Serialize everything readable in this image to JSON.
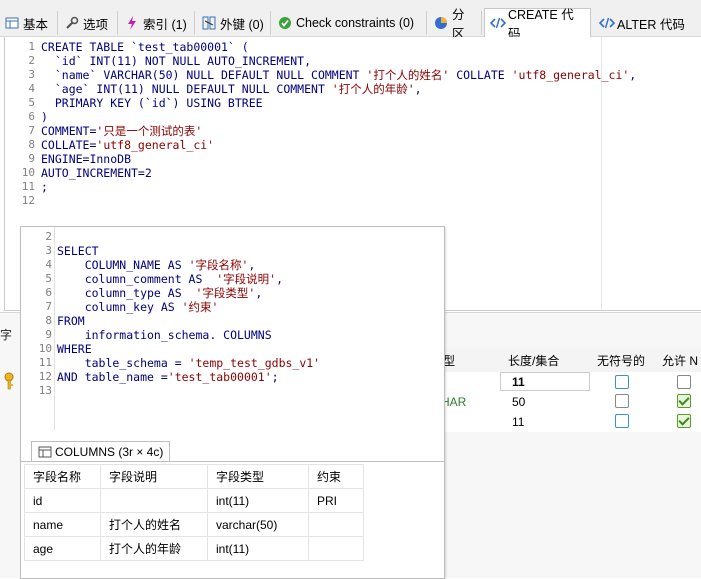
{
  "tabs": [
    {
      "label": "基本",
      "icon": "table-icon"
    },
    {
      "label": "选项",
      "icon": "wrench-icon"
    },
    {
      "label": "索引 (1)",
      "icon": "lightning-icon"
    },
    {
      "label": "外键 (0)",
      "icon": "foreign-key-icon"
    },
    {
      "label": "Check constraints (0)",
      "icon": "check-circle-icon"
    },
    {
      "label": "分区",
      "icon": "pie-chart-icon"
    },
    {
      "label": "CREATE 代码",
      "icon": "code-icon"
    },
    {
      "label": "ALTER 代码",
      "icon": "code-icon"
    }
  ],
  "active_tab": "CREATE 代码",
  "editor": {
    "line_numbers": [
      "1",
      "2",
      "3",
      "4",
      "5",
      "6",
      "7",
      "8",
      "9",
      "10",
      "11",
      "12"
    ],
    "l1": {
      "a": "CREATE TABLE `test_tab00001` ("
    },
    "l2": {
      "a": "  `id` ",
      "b": "INT(11) NOT NULL AUTO_INCREMENT,"
    },
    "l3": {
      "a": "  `name` ",
      "b": "VARCHAR(50) NULL DEFAULT NULL COMMENT ",
      "c": "'打个人的姓名'",
      "d": " COLLATE ",
      "e": "'utf8_general_ci'",
      "f": ","
    },
    "l4": {
      "a": "  `age` ",
      "b": "INT(11) NULL DEFAULT NULL COMMENT ",
      "c": "'打个人的年龄'",
      "d": ","
    },
    "l5": {
      "a": "  PRIMARY KEY (`id`) USING BTREE"
    },
    "l6": {
      "a": ")"
    },
    "l7": {
      "a": "COMMENT=",
      "b": "'只是一个测试的表'"
    },
    "l8": {
      "a": "COLLATE=",
      "b": "'utf8_general_ci'"
    },
    "l9": {
      "a": "ENGINE=InnoDB"
    },
    "l10": {
      "a": "AUTO_INCREMENT=2"
    },
    "l11": {
      "a": ";"
    }
  },
  "background_grid": {
    "headers": [
      "型",
      "长度/集合",
      "无符号的",
      "允许 N"
    ],
    "rows": [
      {
        "type": "",
        "length": "11"
      },
      {
        "type": "HAR",
        "length": "50"
      },
      {
        "type": "",
        "length": "11"
      }
    ],
    "left_fragment": "字"
  },
  "sql_panel": {
    "line_numbers": [
      "2",
      "3",
      "4",
      "5",
      "6",
      "7",
      "8",
      "9",
      "10",
      "11",
      "12",
      "13"
    ],
    "l3": {
      "a": "SELECT"
    },
    "l4": {
      "a": "    COLUMN_NAME AS ",
      "b": "'字段名称'",
      "c": ","
    },
    "l5": {
      "a": "    column_comment AS  ",
      "b": "'字段说明'",
      "c": ","
    },
    "l6": {
      "a": "    column_type AS  ",
      "b": "'字段类型'",
      "c": ","
    },
    "l7": {
      "a": "    column_key AS ",
      "b": "'约束'"
    },
    "l8": {
      "a": "FROM"
    },
    "l9": {
      "a": "    information_schema. COLUMNS"
    },
    "l10": {
      "a": "WHERE"
    },
    "l11": {
      "a": "    table_schema = ",
      "b": "'temp_test_gdbs_v1'"
    },
    "l12": {
      "a": "AND table_name =",
      "b": "'test_tab00001'",
      "c": ";"
    }
  },
  "result": {
    "tab_label": "COLUMNS (3r × 4c)",
    "headers": [
      "字段名称",
      "字段说明",
      "字段类型",
      "约束"
    ],
    "rows": [
      [
        "id",
        "",
        "int(11)",
        "PRI"
      ],
      [
        "name",
        "打个人的姓名",
        "varchar(50)",
        ""
      ],
      [
        "age",
        "打个人的年龄",
        "int(11)",
        ""
      ]
    ]
  },
  "colors": {
    "keyword": "#000080",
    "string": "#8b0000",
    "check_green": "#3b8a16",
    "checkbox_blue": "#3b8ede"
  }
}
